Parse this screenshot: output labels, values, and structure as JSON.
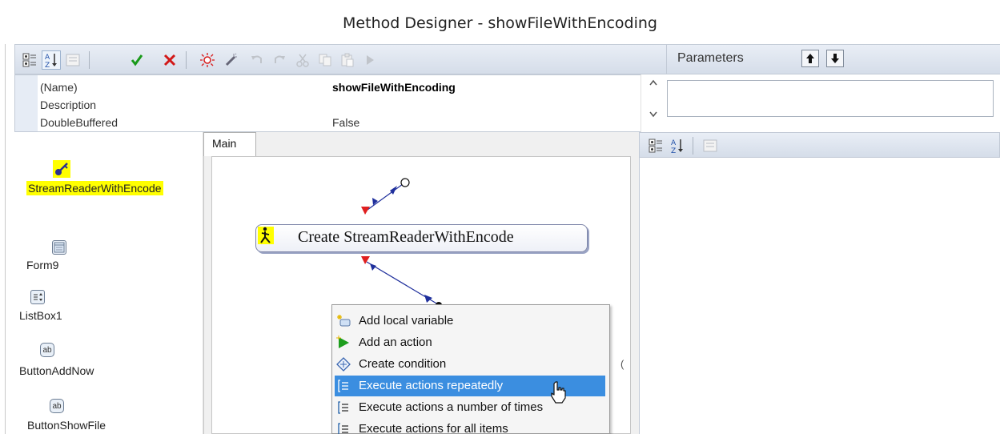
{
  "window": {
    "title": "Method Designer - showFileWithEncoding"
  },
  "toolbar": {
    "buttons": [
      {
        "icon": "categorized-icon"
      },
      {
        "icon": "sort-alpha-icon"
      },
      {
        "icon": "property-pages-icon"
      },
      {
        "icon": "ok-check-icon"
      },
      {
        "icon": "cancel-x-icon"
      },
      {
        "icon": "debug-icon"
      },
      {
        "icon": "magic-wand-icon"
      },
      {
        "icon": "undo-icon"
      },
      {
        "icon": "redo-icon"
      },
      {
        "icon": "cut-icon"
      },
      {
        "icon": "copy-icon"
      },
      {
        "icon": "paste-icon"
      },
      {
        "icon": "run-icon"
      }
    ]
  },
  "parameters": {
    "label": "Parameters",
    "up_icon": "move-up-icon",
    "down_icon": "move-down-icon"
  },
  "property_grid": {
    "rows": [
      {
        "name": "(Name)",
        "value": "showFileWithEncoding"
      },
      {
        "name": "Description",
        "value": ""
      },
      {
        "name": "DoubleBuffered",
        "value": "False"
      }
    ]
  },
  "components": [
    {
      "label": "StreamReaderWithEncode",
      "icon": "key-icon",
      "selected": true
    },
    {
      "label": "Form9",
      "icon": "form-icon"
    },
    {
      "label": "ListBox1",
      "icon": "listbox-icon"
    },
    {
      "label": "ButtonAddNow",
      "icon": "button-icon",
      "icon_text": "ab"
    },
    {
      "label": "ButtonShowFile",
      "icon": "button-icon",
      "icon_text": "ab"
    }
  ],
  "designer": {
    "tab_label": "Main",
    "node_label": "Create StreamReaderWithEncode",
    "node_icon": "walking-man-icon"
  },
  "context_menu": {
    "items": [
      {
        "label": "Add local variable",
        "icon": "variable-icon"
      },
      {
        "label": "Add an action",
        "icon": "action-arrow-icon"
      },
      {
        "label": "Create condition",
        "icon": "condition-diamond-icon"
      },
      {
        "label": "Execute actions repeatedly",
        "icon": "loop-icon",
        "highlighted": true
      },
      {
        "label": "Execute actions a number of times",
        "icon": "loop-count-icon"
      },
      {
        "label": "Execute actions for all items",
        "icon": "loop-items-icon"
      }
    ]
  },
  "colors": {
    "selection_highlight": "#ffff00",
    "menu_highlight": "#3b8ee0",
    "flow_line": "#1f2f9c",
    "flow_arrow_red": "#e02020"
  }
}
